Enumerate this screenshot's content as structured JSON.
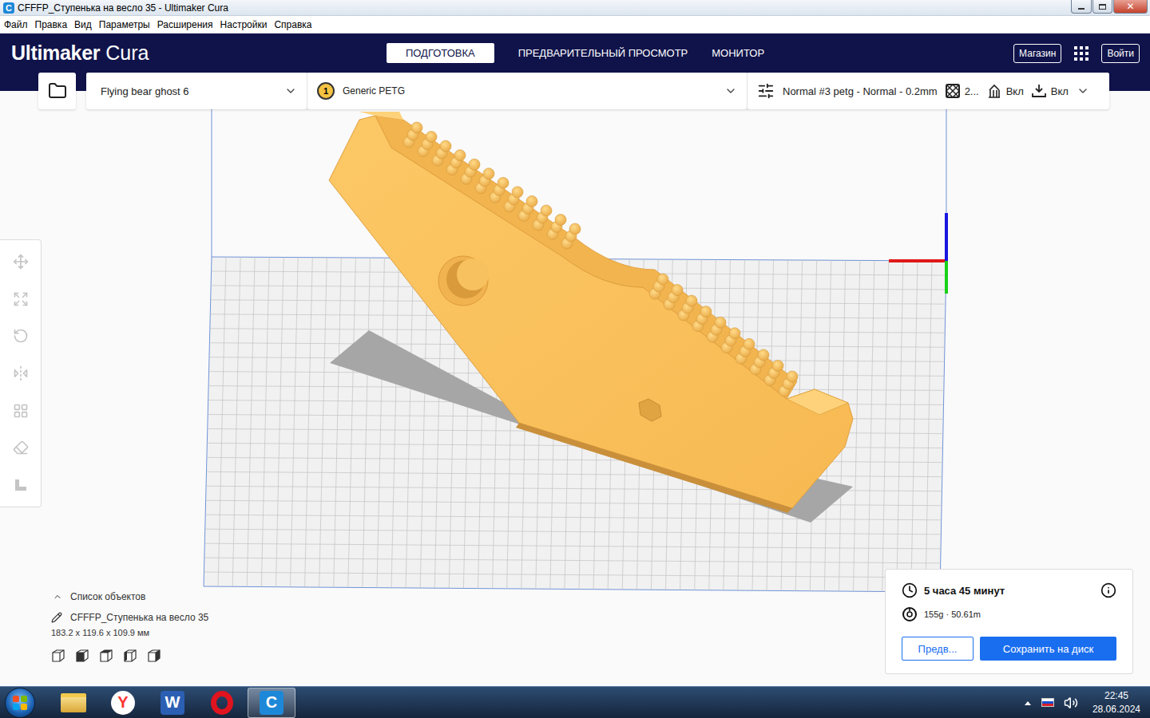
{
  "window": {
    "title": "CFFFP_Ступенька на весло 35 - Ultimaker Cura",
    "app_glyph": "C"
  },
  "menu": [
    "Файл",
    "Правка",
    "Вид",
    "Параметры",
    "Расширения",
    "Настройки",
    "Справка"
  ],
  "header": {
    "logo_brand": "Ultimaker",
    "logo_product": "Cura",
    "tabs": [
      {
        "label": "ПОДГОТОВКА",
        "selected": true
      },
      {
        "label": "ПРЕДВАРИТЕЛЬНЫЙ ПРОСМОТР",
        "selected": false
      },
      {
        "label": "МОНИТОР",
        "selected": false
      }
    ],
    "buttons": [
      "Магазин",
      "Войти"
    ]
  },
  "toolbar": {
    "printer": "Flying bear ghost 6",
    "extruder": "1",
    "material": "Generic PETG",
    "profile": "Normal #3 petg - Normal - 0.2mm",
    "infill": "2...",
    "support": "Вкл",
    "adhesion": "Вкл"
  },
  "tools": [
    {
      "kind": "move",
      "disabled": true
    },
    {
      "kind": "scale",
      "disabled": true
    },
    {
      "kind": "rotate",
      "disabled": true
    },
    {
      "kind": "mirror",
      "disabled": true
    },
    {
      "kind": "permodel",
      "disabled": true
    },
    {
      "kind": "blocker",
      "disabled": true
    },
    {
      "kind": "layflat",
      "disabled": true
    }
  ],
  "objects": {
    "title": "Список объектов",
    "expanded": false,
    "name": "CFFFP_Ступенька на весло 35",
    "dimensions": "183.2 x 119.6 x 109.9 мм"
  },
  "print": {
    "time": "5 часа 45 минут",
    "material": "155g · 50.61m",
    "preview_button": "Предв...",
    "save_button": "Сохранить на диск"
  },
  "taskbar": {
    "apps": [
      {
        "kind": "explorer",
        "selected": false
      },
      {
        "kind": "yandex",
        "glyph": "Y",
        "selected": false
      },
      {
        "kind": "word",
        "glyph": "W",
        "selected": false
      },
      {
        "kind": "opera",
        "selected": false
      },
      {
        "kind": "cura",
        "glyph": "C",
        "selected": true
      }
    ],
    "time": "22:45",
    "date": "28.06.2024"
  }
}
